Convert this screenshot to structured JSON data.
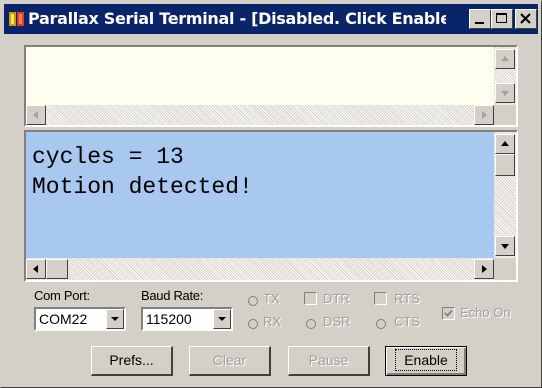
{
  "window": {
    "title": "Parallax Serial Terminal - [Disabled. Click Enable butt...",
    "icon": "parallax-app-icon"
  },
  "transmit_pane": {
    "text": "",
    "background": "#fffff0"
  },
  "receive_pane": {
    "lines": [
      "cycles = 13",
      "Motion detected!"
    ],
    "background": "#a8c8f0"
  },
  "settings": {
    "com_port_label": "Com Port:",
    "com_port_value": "COM22",
    "baud_rate_label": "Baud Rate:",
    "baud_rate_value": "115200"
  },
  "indicators": {
    "tx": "TX",
    "rx": "RX",
    "dtr": "DTR",
    "dsr": "DSR",
    "rts": "RTS",
    "cts": "CTS",
    "echo_on": "Echo On",
    "echo_on_checked": true
  },
  "buttons": {
    "prefs": "Prefs...",
    "clear": "Clear",
    "pause": "Pause",
    "enable": "Enable"
  }
}
